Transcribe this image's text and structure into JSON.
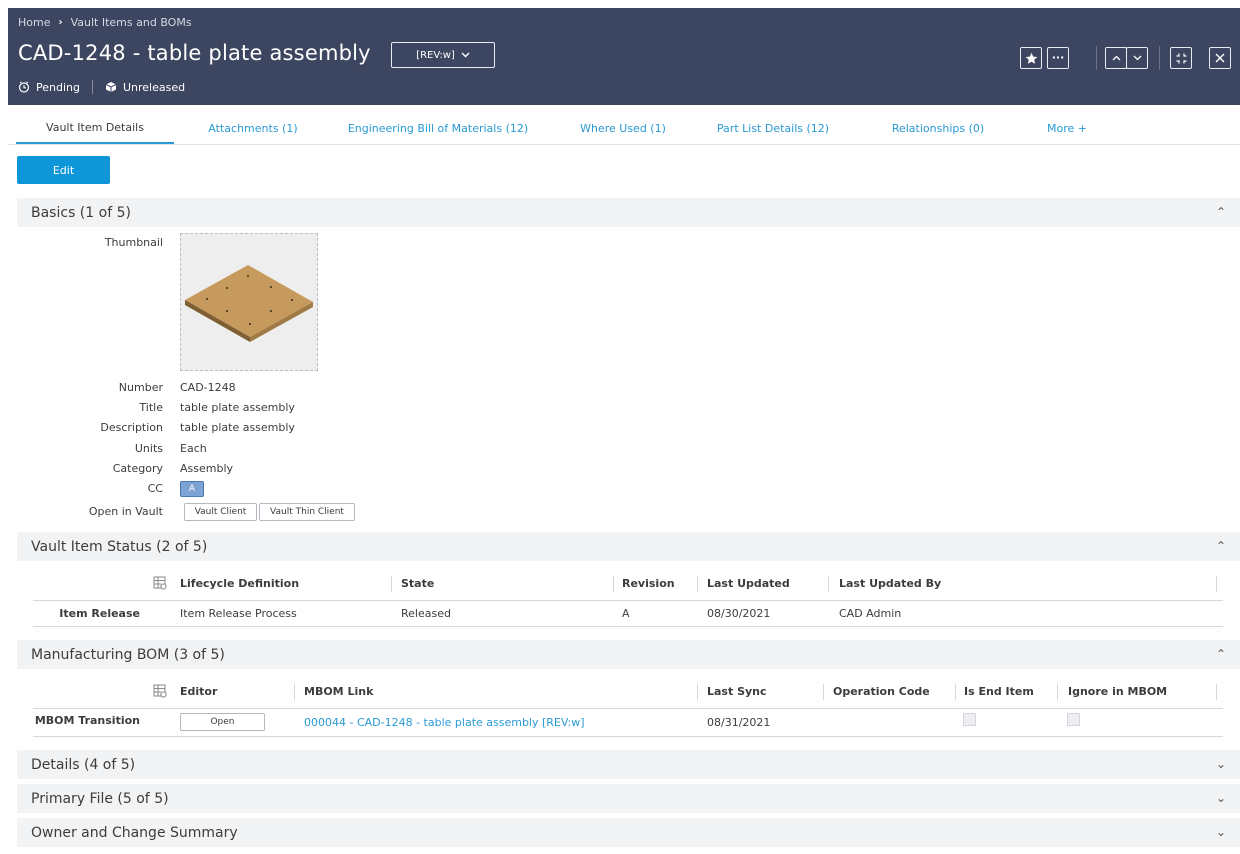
{
  "header": {
    "breadcrumb": [
      "Home",
      "Vault Items and BOMs"
    ],
    "title": "CAD-1248 - table plate assembly",
    "revision": "[REV:w]",
    "status": "Pending",
    "release": "Unreleased"
  },
  "tabs": [
    {
      "label": "Vault Item Details",
      "active": true
    },
    {
      "label": "Attachments (1)"
    },
    {
      "label": "Engineering Bill of Materials (12)"
    },
    {
      "label": "Where Used (1)"
    },
    {
      "label": "Part List Details (12)"
    },
    {
      "label": "Relationships (0)"
    },
    {
      "label": "More +"
    }
  ],
  "edit_label": "Edit",
  "sections": {
    "basics": "Basics (1 of 5)",
    "status": "Vault Item Status (2 of 5)",
    "mbom": "Manufacturing BOM (3 of 5)",
    "details": "Details (4 of 5)",
    "primary": "Primary File (5 of 5)",
    "owner": "Owner and Change Summary"
  },
  "basics": {
    "thumbnail_label": "Thumbnail",
    "fields": [
      {
        "label": "Number",
        "value": "CAD-1248"
      },
      {
        "label": "Title",
        "value": "table plate assembly"
      },
      {
        "label": "Description",
        "value": "table plate assembly"
      },
      {
        "label": "Units",
        "value": "Each"
      },
      {
        "label": "Category",
        "value": "Assembly"
      }
    ],
    "cc_label": "CC",
    "cc_value": "A",
    "open_label": "Open in Vault",
    "vault_client": "Vault Client",
    "vault_thin_client": "Vault Thin Client"
  },
  "status_table": {
    "headers": [
      "Lifecycle Definition",
      "State",
      "Revision",
      "Last Updated",
      "Last Updated By"
    ],
    "row_label": "Item Release",
    "row": [
      "Item Release Process",
      "Released",
      "A",
      "08/30/2021",
      "CAD Admin"
    ]
  },
  "mbom_table": {
    "headers": [
      "Editor",
      "MBOM Link",
      "Last Sync",
      "Operation Code",
      "Is End Item",
      "Ignore in MBOM"
    ],
    "row_label": "MBOM Transition",
    "open_label": "Open",
    "link": "000044 - CAD-1248 - table plate assembly [REV:w]",
    "last_sync": "08/31/2021",
    "operation_code": "",
    "is_end_item": false,
    "ignore_in_mbom": false
  },
  "colors": {
    "header_bg": "#3d4661",
    "accent": "#0f96d8",
    "link": "#2a9ad6"
  }
}
